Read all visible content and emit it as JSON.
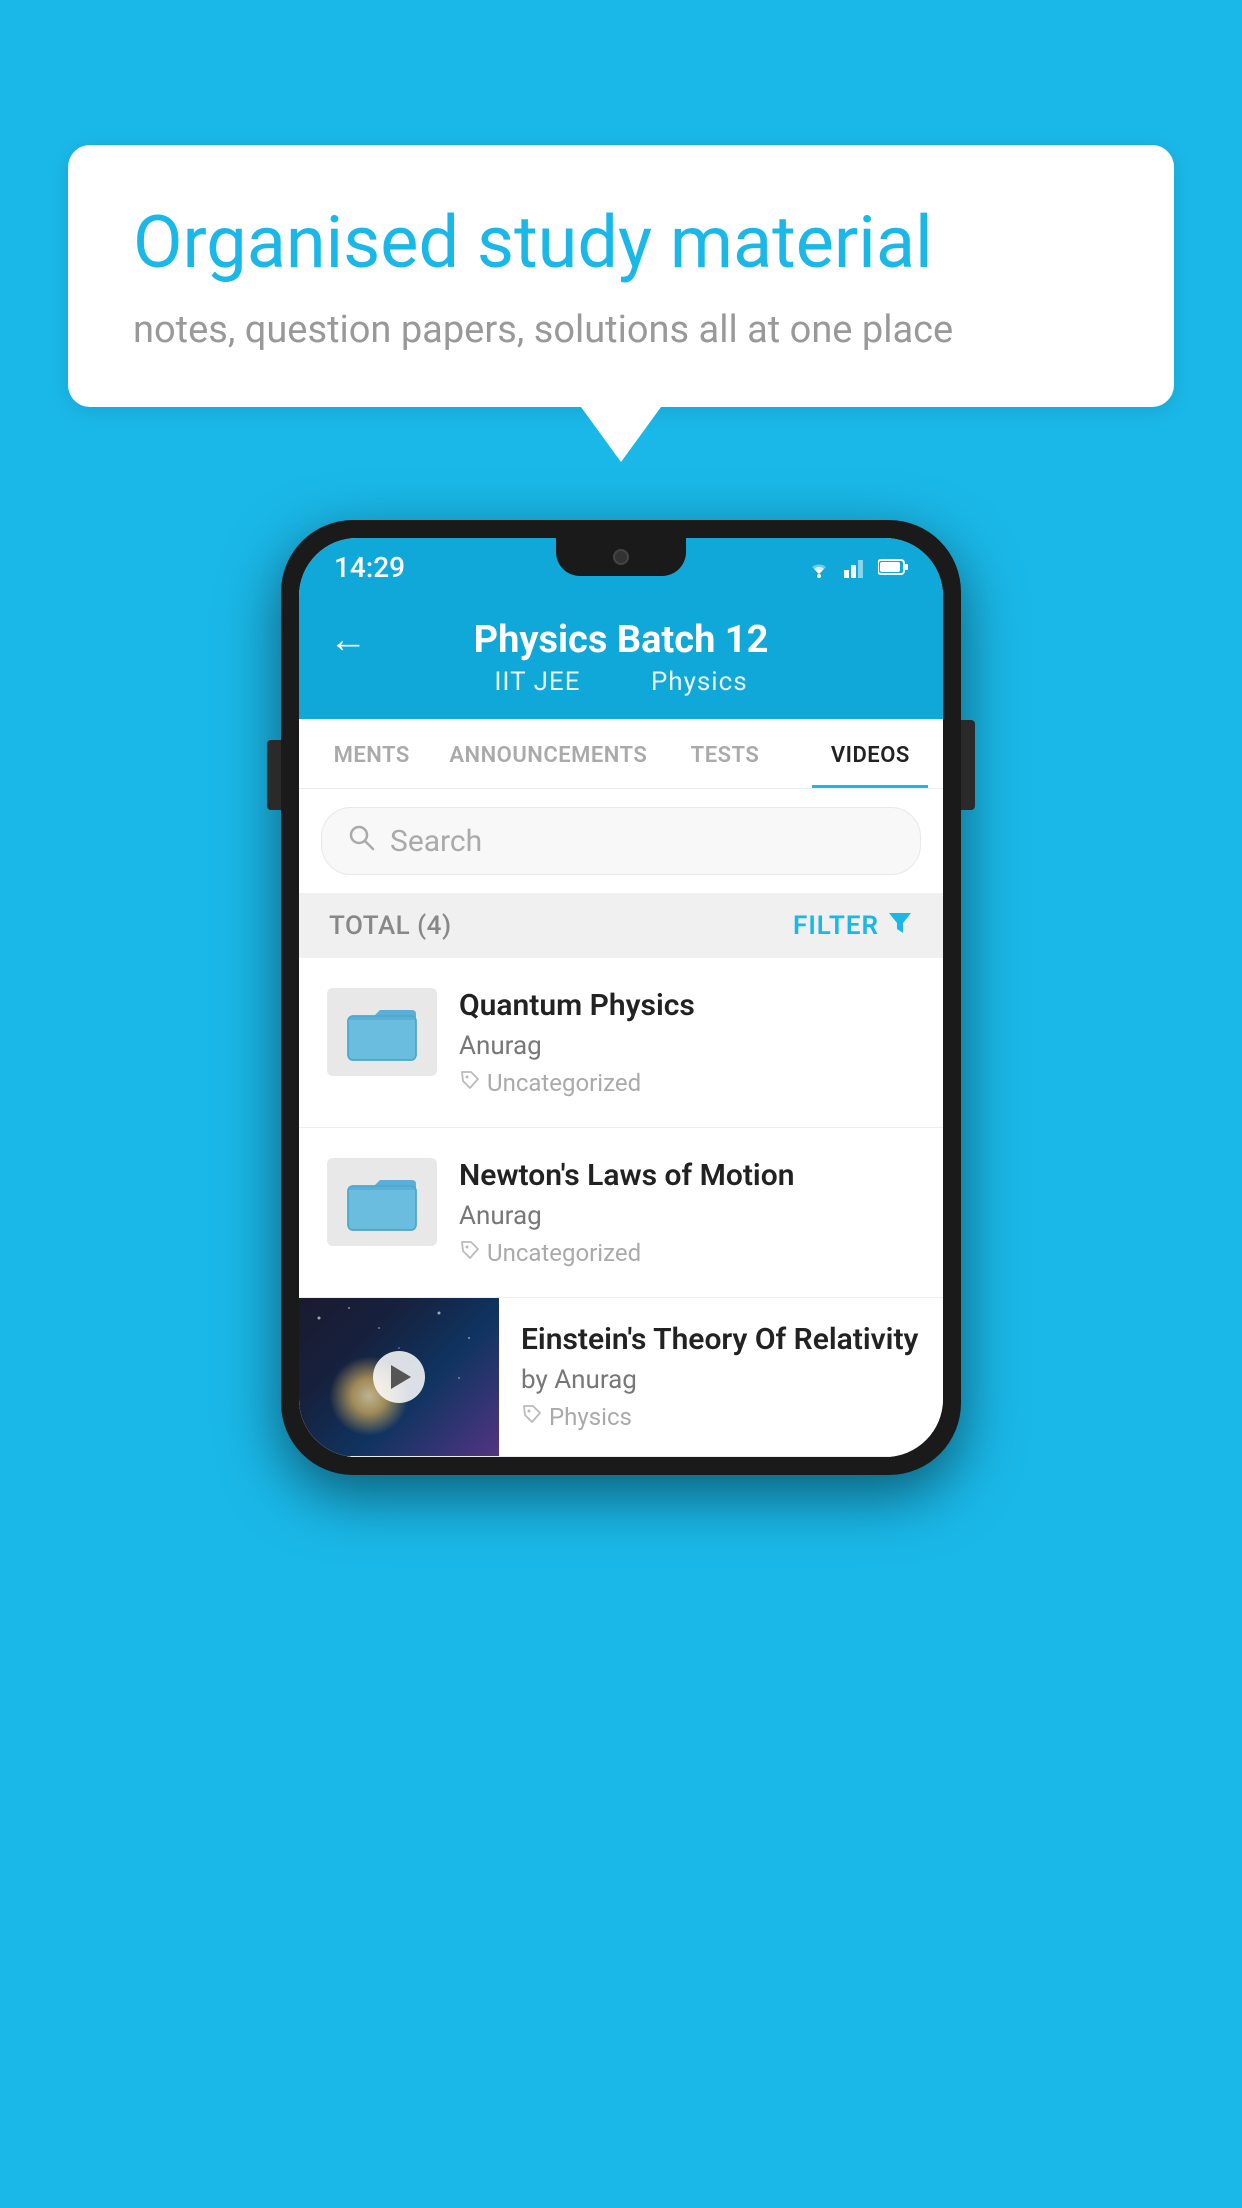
{
  "background_color": "#1ab8e8",
  "speech_bubble": {
    "title": "Organised study material",
    "subtitle": "notes, question papers, solutions all at one place"
  },
  "status_bar": {
    "time": "14:29"
  },
  "app_header": {
    "title": "Physics Batch 12",
    "subtitle_part1": "IIT JEE",
    "subtitle_part2": "Physics",
    "back_label": "←"
  },
  "tabs": [
    {
      "label": "MENTS",
      "active": false
    },
    {
      "label": "ANNOUNCEMENTS",
      "active": false
    },
    {
      "label": "TESTS",
      "active": false
    },
    {
      "label": "VIDEOS",
      "active": true
    }
  ],
  "search": {
    "placeholder": "Search"
  },
  "filter_bar": {
    "total_label": "TOTAL (4)",
    "filter_label": "FILTER"
  },
  "videos": [
    {
      "id": "quantum",
      "title": "Quantum Physics",
      "author": "Anurag",
      "tag": "Uncategorized",
      "type": "folder"
    },
    {
      "id": "newton",
      "title": "Newton's Laws of Motion",
      "author": "Anurag",
      "tag": "Uncategorized",
      "type": "folder"
    },
    {
      "id": "einstein",
      "title": "Einstein's Theory Of Relativity",
      "author": "by Anurag",
      "tag": "Physics",
      "type": "video"
    }
  ]
}
